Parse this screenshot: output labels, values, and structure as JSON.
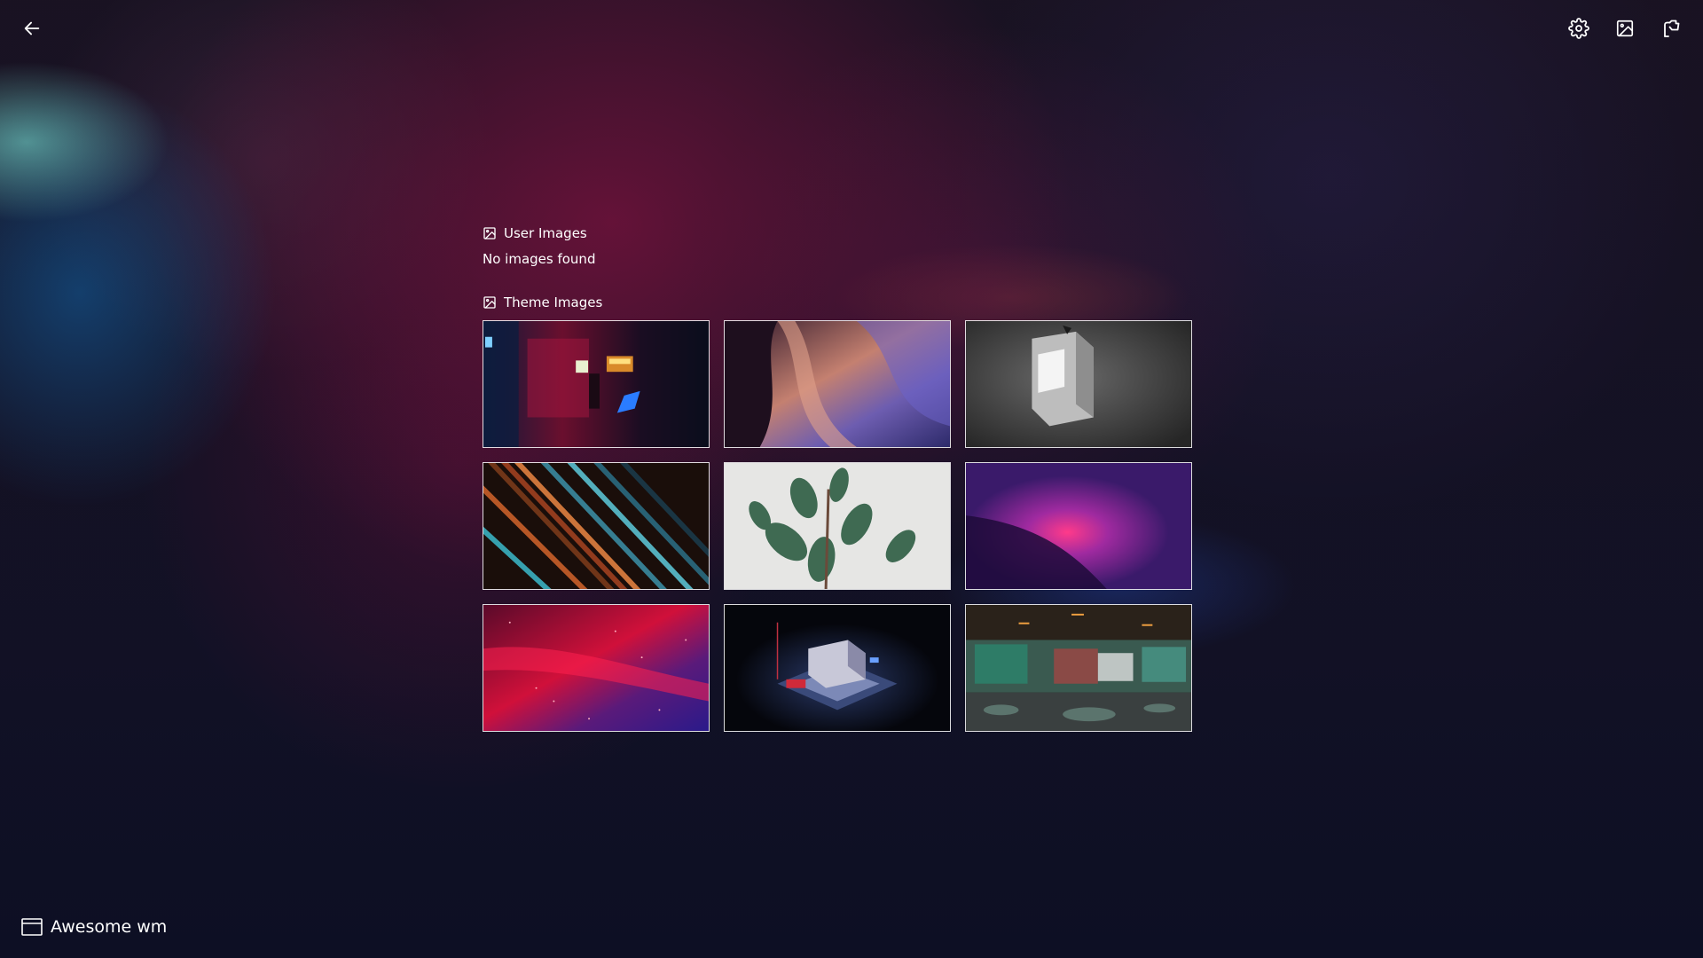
{
  "toolbar": {
    "back_icon": "arrow-left-icon",
    "settings_icon": "gear-icon",
    "wallpaper_icon": "image-icon",
    "flag_icon": "flag-icon"
  },
  "user_images": {
    "title": "User Images",
    "empty_text": "No images found"
  },
  "theme_images": {
    "title": "Theme Images",
    "items": [
      {
        "id": "arcade-room"
      },
      {
        "id": "canyon-rock"
      },
      {
        "id": "retro-computer"
      },
      {
        "id": "light-streaks"
      },
      {
        "id": "rubber-plant"
      },
      {
        "id": "purple-pink-gradient"
      },
      {
        "id": "red-galaxy"
      },
      {
        "id": "isometric-gas-station"
      },
      {
        "id": "graffiti-tunnel"
      }
    ]
  },
  "session": {
    "label": "Awesome wm",
    "icon": "window-icon"
  }
}
